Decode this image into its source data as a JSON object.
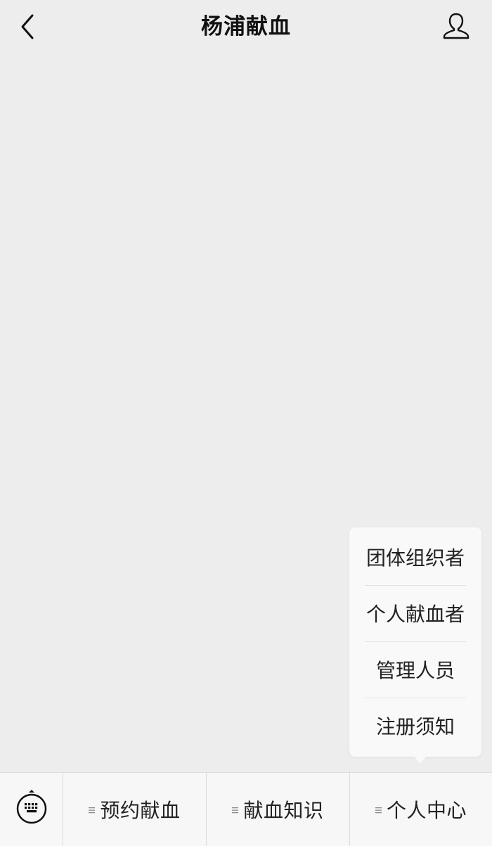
{
  "header": {
    "title": "杨浦献血"
  },
  "submenu": {
    "items": [
      {
        "label": "团体组织者"
      },
      {
        "label": "个人献血者"
      },
      {
        "label": "管理人员"
      },
      {
        "label": "注册须知"
      }
    ]
  },
  "menubar": {
    "tabs": [
      {
        "label": "预约献血",
        "icon": "menu-lines-icon"
      },
      {
        "label": "献血知识",
        "icon": "menu-lines-icon"
      },
      {
        "label": "个人中心",
        "icon": "menu-lines-icon"
      }
    ]
  },
  "colors": {
    "background": "#ededed",
    "menubar": "#f7f7f7",
    "popup": "#f9f9f9",
    "text": "#111111"
  }
}
